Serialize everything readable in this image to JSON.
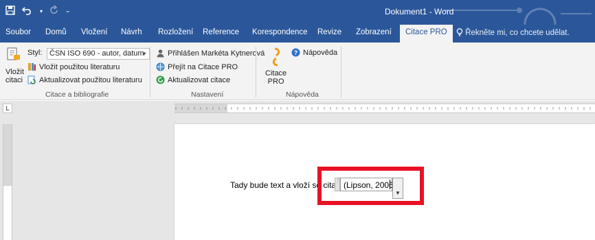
{
  "window": {
    "title": "Dokument1 - Word"
  },
  "qat": {
    "save_icon": "save-icon",
    "undo_icon": "undo-icon",
    "redo_icon": "redo-icon",
    "customize_icon": "customize-qat-icon"
  },
  "tabs": [
    {
      "label": "Soubor"
    },
    {
      "label": "Domů"
    },
    {
      "label": "Vložení"
    },
    {
      "label": "Návrh"
    },
    {
      "label": "Rozložení"
    },
    {
      "label": "Reference"
    },
    {
      "label": "Korespondence"
    },
    {
      "label": "Revize"
    },
    {
      "label": "Zobrazení"
    },
    {
      "label": "Citace PRO"
    }
  ],
  "tell_me": {
    "placeholder": "Řekněte mi, co chcete udělat."
  },
  "ribbon": {
    "insert_citation": {
      "line1": "Vložit",
      "line2": "citaci"
    },
    "style_label": "Styl:",
    "style_value": "ČSN ISO 690 - autor, datum",
    "insert_bibliography": "Vložit použitou literaturu",
    "update_bibliography": "Aktualizovat použitou literaturu",
    "group1_label": "Citace a bibliografie",
    "signed_in": "Přihlášen Markéta Kytnerová",
    "go_to_citace": "Přejít na Citace PRO",
    "update_citations": "Aktualizovat citace",
    "group2_label": "Nastavení",
    "citace_pro_btn": {
      "line1": "Citace",
      "line2": "PRO"
    },
    "help": "Nápověda",
    "group3_label": "Nápověda"
  },
  "ruler": {
    "corner": "L"
  },
  "document": {
    "body_text": "Tady bude text a vloží se citace",
    "citation": "(Lipson, 2006)"
  },
  "colors": {
    "title_bar": "#2b579a",
    "highlight": "#e81123",
    "ribbon": "#f3f3f3"
  }
}
